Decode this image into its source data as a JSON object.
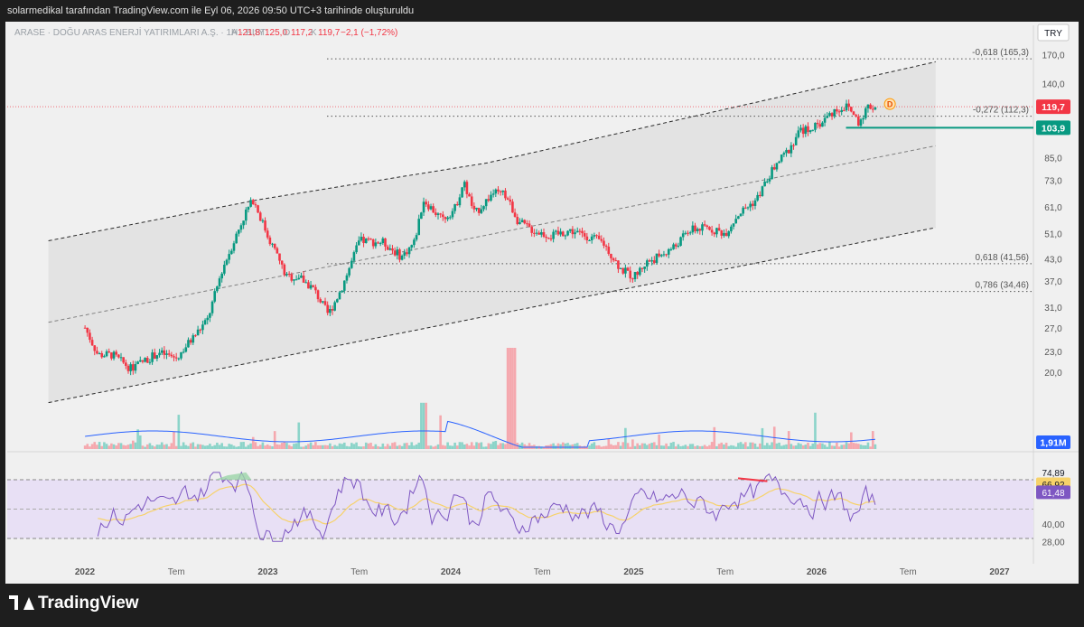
{
  "header": {
    "credit": "solarmedikal tarafından TradingView.com ile Eyl 06, 2026 09:50 UTC+3 tarihinde oluşturuldu"
  },
  "legend": {
    "symbol": "ARASE · DOĞU ARAS ENERJİ YATIRIMLARI A.Ş. · 1H · BIST",
    "a_label": "A",
    "a_value": "121,8",
    "y_label": "Y",
    "y_value": "125,0",
    "d_label": "D",
    "d_value": "117,2",
    "k_label": "K",
    "k_value": "119,7",
    "change": "−2,1 (−1,72%)"
  },
  "currency": "TRY",
  "footer": {
    "brand": "TradingView"
  },
  "colors": {
    "up": "#089981",
    "down": "#f23645",
    "rsi": "#7e57c2",
    "rsi_ma": "#f7d26a",
    "vol_ma": "#2962ff"
  },
  "chart_data": [
    {
      "type": "candlestick",
      "scale": "log",
      "price_ticks": [
        170.0,
        140.0,
        119.7,
        103.9,
        85.0,
        73.0,
        61.0,
        51.0,
        43.0,
        37.0,
        31.0,
        27.0,
        23.0,
        20.0
      ],
      "tick_labels": [
        "170,0",
        "140,0",
        "119,7",
        "103,9",
        "85,0",
        "73,0",
        "61,0",
        "51,0",
        "43,0",
        "37,0",
        "31,0",
        "27,0",
        "23,0",
        "20,0"
      ],
      "x_labels": [
        "2022",
        "Tem",
        "2023",
        "Tem",
        "2024",
        "Tem",
        "2025",
        "Tem",
        "2026",
        "Tem",
        "2027"
      ],
      "x_label_dates": [
        2022.0,
        2022.5,
        2023.0,
        2023.5,
        2024.0,
        2024.5,
        2025.0,
        2025.5,
        2026.0,
        2026.5,
        2027.0
      ],
      "last_price": {
        "value": 119.7,
        "label": "119,7"
      },
      "support_line": {
        "value": 103.9,
        "label": "103,9"
      },
      "fib_levels": [
        {
          "value": 165.3,
          "label": "-0,618 (165,3)"
        },
        {
          "value": 112.3,
          "label": "-0,272 (112,3)"
        },
        {
          "value": 41.56,
          "label": "0,618 (41,56)"
        },
        {
          "value": 34.46,
          "label": "0,786 (34,46)"
        }
      ],
      "channel": {
        "upper": [
          [
            2021.85,
            48.5
          ],
          [
            2023.0,
            64.0
          ],
          [
            2024.25,
            82.0
          ],
          [
            2026.7,
            162.0
          ]
        ],
        "lower": [
          [
            2021.85,
            16.3
          ],
          [
            2026.7,
            53.0
          ]
        ],
        "middle": [
          [
            2021.85,
            28.0
          ],
          [
            2026.7,
            92.0
          ]
        ]
      },
      "marker": "D",
      "volume": {
        "label": "1,91M",
        "value": 1.91
      },
      "ohlc_path": [
        [
          2022.05,
          27.0
        ],
        [
          2022.12,
          22.5
        ],
        [
          2022.2,
          22.5
        ],
        [
          2022.3,
          20.5
        ],
        [
          2022.45,
          22.8
        ],
        [
          2022.55,
          22.0
        ],
        [
          2022.62,
          24.5
        ],
        [
          2022.72,
          28.5
        ],
        [
          2022.8,
          40.0
        ],
        [
          2022.93,
          59.0
        ],
        [
          2022.97,
          64.0
        ],
        [
          2023.05,
          50.0
        ],
        [
          2023.1,
          44.0
        ],
        [
          2023.15,
          38.0
        ],
        [
          2023.22,
          38.0
        ],
        [
          2023.3,
          35.0
        ],
        [
          2023.38,
          29.5
        ],
        [
          2023.45,
          35.0
        ],
        [
          2023.5,
          41.0
        ],
        [
          2023.55,
          48.5
        ],
        [
          2023.68,
          48.0
        ],
        [
          2023.78,
          43.5
        ],
        [
          2023.85,
          48.0
        ],
        [
          2023.9,
          64.0
        ],
        [
          2024.0,
          56.0
        ],
        [
          2024.07,
          60.0
        ],
        [
          2024.12,
          72.0
        ],
        [
          2024.18,
          58.0
        ],
        [
          2024.28,
          67.0
        ],
        [
          2024.35,
          66.0
        ],
        [
          2024.42,
          55.0
        ],
        [
          2024.5,
          52.0
        ],
        [
          2024.6,
          50.0
        ],
        [
          2024.7,
          52.0
        ],
        [
          2024.8,
          50.0
        ],
        [
          2024.88,
          48.0
        ],
        [
          2024.93,
          44.0
        ],
        [
          2024.98,
          40.0
        ],
        [
          2025.05,
          38.0
        ],
        [
          2025.12,
          42.0
        ],
        [
          2025.2,
          44.0
        ],
        [
          2025.28,
          47.0
        ],
        [
          2025.35,
          52.0
        ],
        [
          2025.45,
          53.0
        ],
        [
          2025.55,
          51.0
        ],
        [
          2025.62,
          58.0
        ],
        [
          2025.72,
          64.0
        ],
        [
          2025.82,
          80.0
        ],
        [
          2025.9,
          90.0
        ],
        [
          2025.95,
          101.0
        ],
        [
          2026.05,
          105.0
        ],
        [
          2026.15,
          117.0
        ],
        [
          2026.22,
          120.0
        ],
        [
          2026.28,
          108.0
        ],
        [
          2026.33,
          120.0
        ],
        [
          2026.37,
          119.7
        ]
      ]
    },
    {
      "type": "line",
      "name": "RSI",
      "ticks": [
        74.89,
        66.92,
        61.48,
        40.0,
        28.0
      ],
      "tick_labels": [
        "74,89",
        "66,92",
        "61,48",
        "40,00",
        "28,00"
      ],
      "upper_band": 70,
      "middle_band": 50,
      "lower_band": 30,
      "rsi_value": {
        "value": 61.48,
        "label": "61,48"
      },
      "ma_value": {
        "value": 66.92,
        "label": "66,92"
      },
      "max_label": "74,89"
    }
  ]
}
